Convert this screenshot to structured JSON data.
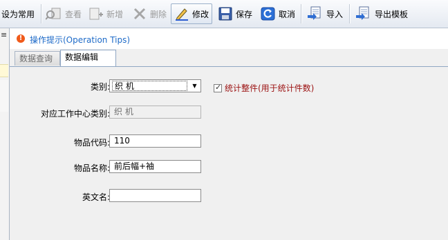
{
  "toolbar": {
    "set_common": "设为常用",
    "view": "查看",
    "add": "新增",
    "delete": "删除",
    "edit": "修改",
    "save": "保存",
    "cancel": "取消",
    "import": "导入",
    "export_template": "导出模板"
  },
  "tips": {
    "text": "操作提示(Operation Tips)"
  },
  "tabs": [
    {
      "label": "数据查询",
      "active": false
    },
    {
      "label": "数据编辑",
      "active": true
    }
  ],
  "form": {
    "category_label": "类别:",
    "category_value": "织 机",
    "count_whole_label": "统计整件(用于统计件数)",
    "count_whole_checked": true,
    "work_center_label": "对应工作中心类别:",
    "work_center_value": "织 机",
    "item_code_label": "物品代码:",
    "item_code_value": "110",
    "item_name_label": "物品名称:",
    "item_name_value": "前后幅+袖",
    "english_name_label": "英文名:",
    "english_name_value": ""
  },
  "colors": {
    "tips_text": "#1d6ac8",
    "checkbox_text": "#9b1010",
    "warn_icon": "#f05a1a"
  }
}
